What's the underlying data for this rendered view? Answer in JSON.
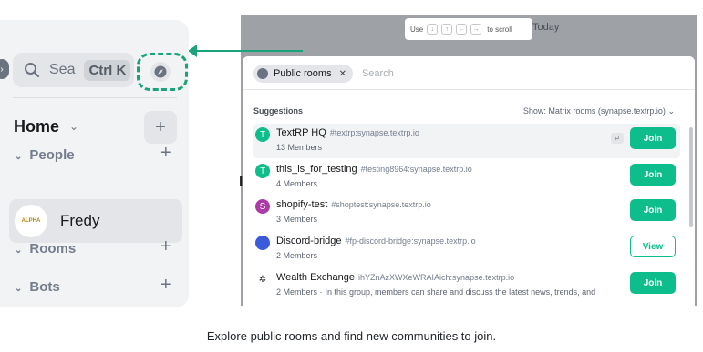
{
  "sidebar": {
    "search_label": "Sea",
    "search_shortcut": "Ctrl K",
    "home_label": "Home",
    "sections": [
      {
        "label": "People"
      },
      {
        "label": "Rooms"
      },
      {
        "label": "Bots"
      }
    ],
    "dm": {
      "name": "Fredy",
      "avatar_text": "ALPHA"
    }
  },
  "backdrop": {
    "today_label": "Today",
    "scroll_hint": {
      "use": "Use",
      "to_scroll": "to scroll"
    }
  },
  "dialog": {
    "chip_label": "Public rooms",
    "search_placeholder": "Search",
    "suggestions_label": "Suggestions",
    "show_label": "Show: Matrix rooms (synapse.textrp.io)",
    "rooms": [
      {
        "avatar": "T",
        "color": "#0dbd8b",
        "name": "TextRP HQ",
        "alias": "#textrp:synapse.textrp.io",
        "members": "13 Members",
        "topic": "",
        "action": "Join"
      },
      {
        "avatar": "T",
        "color": "#0dbd8b",
        "name": "this_is_for_testing",
        "alias": "#testing8964:synapse.textrp.io",
        "members": "4 Members",
        "topic": "",
        "action": "Join"
      },
      {
        "avatar": "S",
        "color": "#ac3ba8",
        "name": "shopify-test",
        "alias": "#shoptest:synapse.textrp.io",
        "members": "3 Members",
        "topic": "",
        "action": "Join"
      },
      {
        "avatar": "",
        "color": "#3b5bdb",
        "name": "Discord-bridge",
        "alias": "#fp-discord-bridge:synapse.textrp.io",
        "members": "2 Members",
        "topic": "",
        "action": "View"
      },
      {
        "avatar": "",
        "color": "#ffffff",
        "name": "Wealth Exchange",
        "alias": "ihYZnAzXWXeWRAIAich:synapse.textrp.io",
        "members": "2 Members ·",
        "topic": "In this group, members can share and discuss the latest news, trends, and",
        "action": "Join"
      }
    ]
  },
  "caption": "Explore public rooms and find new communities to join.",
  "colors": {
    "accent": "#0dbd8b",
    "annotation": "#1aa37a"
  }
}
